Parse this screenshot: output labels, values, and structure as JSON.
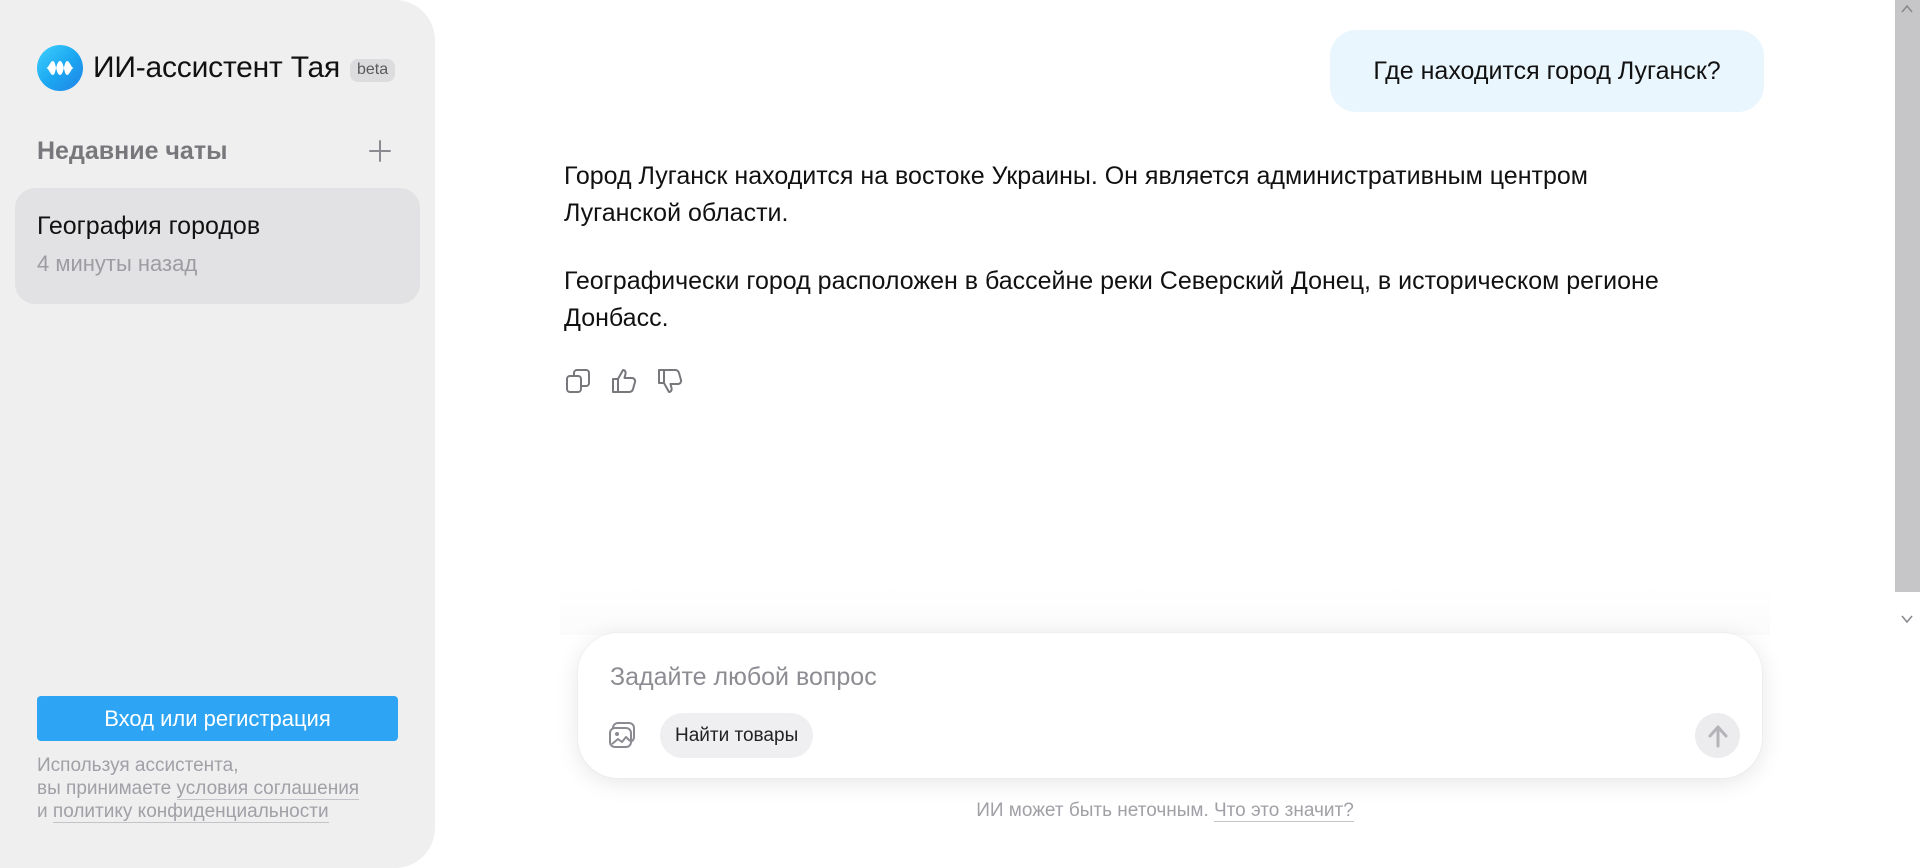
{
  "brand": {
    "title": "ИИ-ассистент Тая",
    "badge": "beta",
    "accent_color": "#2ea5f4"
  },
  "sidebar": {
    "recent_title": "Недавние чаты",
    "add_icon": "plus-icon",
    "chats": [
      {
        "title": "География городов",
        "time": "4 минуты назад"
      }
    ],
    "login_label": "Вход или регистрация",
    "legal": {
      "line1": "Используя ассистента,",
      "line2_prefix": "вы принимаете ",
      "terms_link": "условия соглашения",
      "line3_prefix": "и ",
      "privacy_link": "политику конфиденциальности"
    }
  },
  "conversation": {
    "user_message": "Где находится город Луганск?",
    "assistant_paragraphs": [
      "Город Луганск находится на востоке Украины. Он является административным центром Луганской области.",
      "Географически город расположен в бассейне реки Северский Донец, в историческом регионе Донбасс."
    ],
    "actions": [
      "copy-icon",
      "thumbs-up-icon",
      "thumbs-down-icon"
    ]
  },
  "composer": {
    "placeholder": "Задайте любой вопрос",
    "value": "",
    "image_icon": "image-icon",
    "chip_label": "Найти товары",
    "send_icon": "arrow-up-icon"
  },
  "footer": {
    "disclaimer": "ИИ может быть неточным.",
    "link": "Что это значит?"
  }
}
